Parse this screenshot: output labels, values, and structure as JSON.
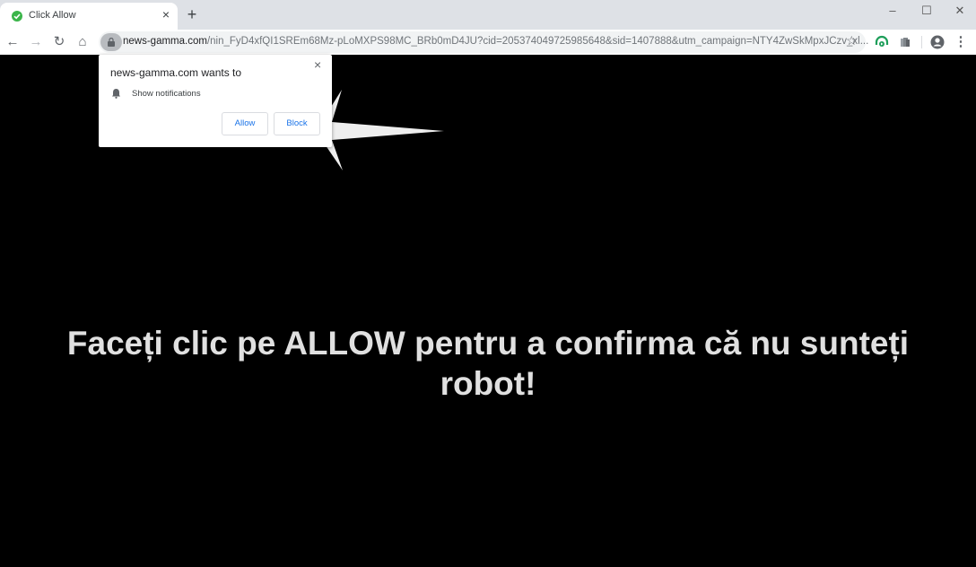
{
  "browser": {
    "tab": {
      "title": "Click Allow",
      "close_label": "×"
    },
    "new_tab_label": "+",
    "window_controls": {
      "minimize": "–",
      "maximize": "☐",
      "close": "✕"
    },
    "nav": {
      "back": "←",
      "forward": "→",
      "reload": "↻",
      "home": "⌂"
    },
    "address": {
      "host": "news-gamma.com",
      "path": "/nin_FyD4xfQI1SREm68Mz-pLoMXPS98MC_BRb0mD4JU?cid=205374049725985648&sid=1407888&utm_campaign=NTY4ZwSkMpxJCzv_xl..."
    },
    "star_label": "☆",
    "menu_label": "⋮"
  },
  "permission_popup": {
    "title": "news-gamma.com wants to",
    "permission": "Show notifications",
    "close_label": "×",
    "allow_label": "Allow",
    "block_label": "Block"
  },
  "page": {
    "headline": "Faceți clic pe ALLOW pentru a confirma că nu sunteți robot!"
  }
}
